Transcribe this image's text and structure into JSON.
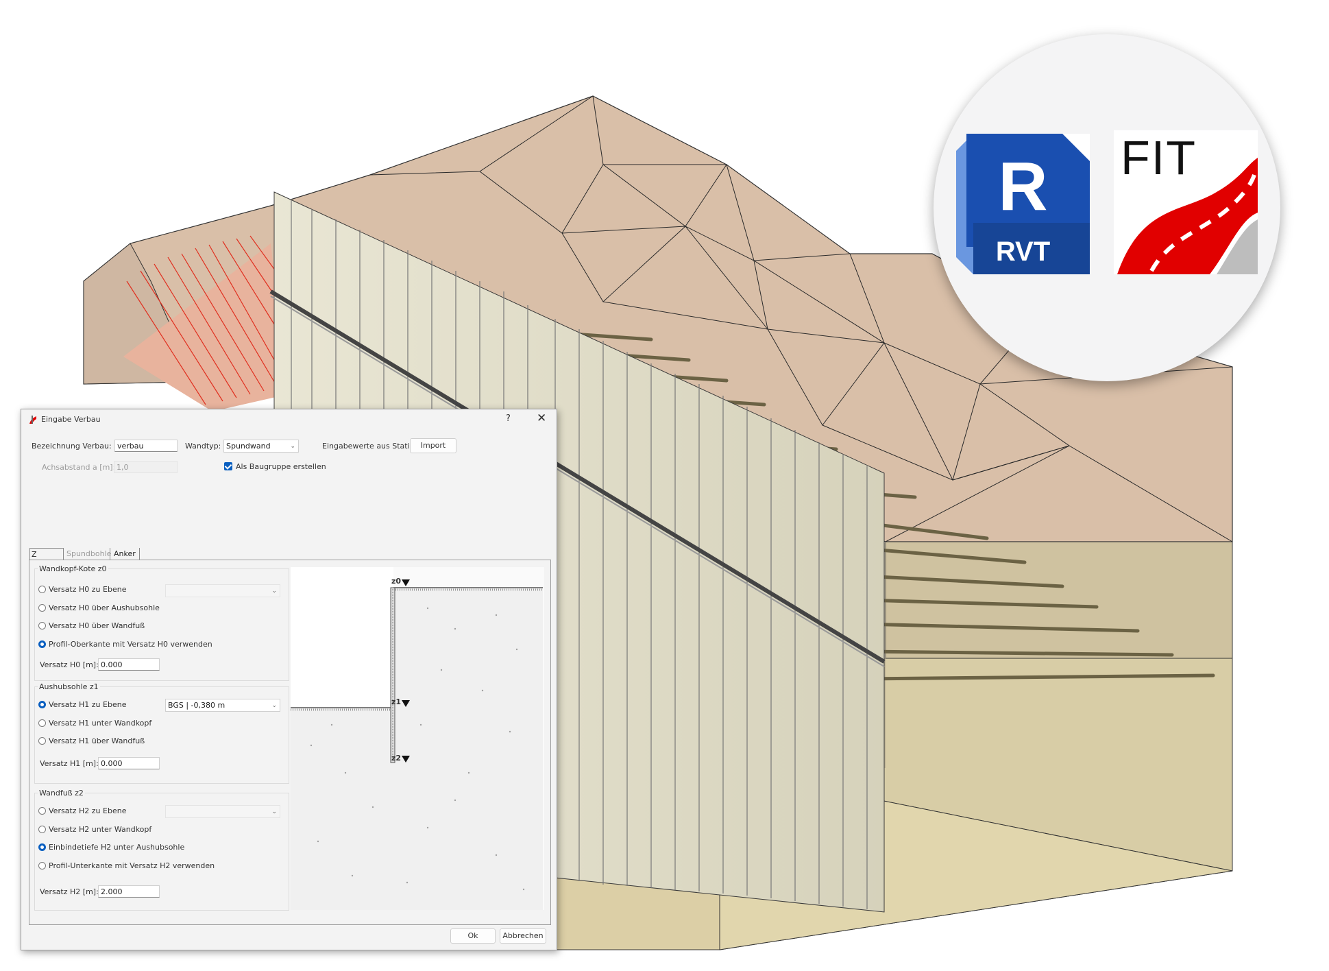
{
  "logos": {
    "rvt": {
      "letter": "R",
      "label": "RVT",
      "color": "#1a4fb0",
      "accent": "#6a97e0"
    },
    "fit": {
      "label": "FIT",
      "road_color": "#e10000"
    }
  },
  "dialog": {
    "title": "Eingabe Verbau",
    "help": "?",
    "close": "✕",
    "bezeichnung_label": "Bezeichnung Verbau:",
    "bezeichnung_value": "verbau",
    "wandtyp_label": "Wandtyp:",
    "wandtyp_value": "Spundwand",
    "statik_label": "Eingabewerte aus Statik:",
    "import_label": "Import",
    "achsabstand_label": "Achsabstand a [m]:",
    "achsabstand_value": "1,0",
    "baugruppe_label": "Als Baugruppe erstellen",
    "baugruppe_checked": true,
    "tabs": [
      "Z Höhen",
      "Spundbohle",
      "Anker"
    ],
    "active_tab": "Z Höhen",
    "groups": {
      "z0": {
        "title": "Wandkopf-Kote z0",
        "options": [
          "Versatz H0 zu Ebene",
          "Versatz H0 über Aushubsohle",
          "Versatz H0 über Wandfuß",
          "Profil-Oberkante mit Versatz H0 verwenden"
        ],
        "selected": 3,
        "select_value": "",
        "field_label": "Versatz H0 [m]:",
        "field_value": "0.000"
      },
      "z1": {
        "title": "Aushubsohle z1",
        "options": [
          "Versatz H1 zu Ebene",
          "Versatz H1 unter Wandkopf",
          "Versatz H1 über Wandfuß"
        ],
        "selected": 0,
        "select_value": "BGS | -0,380 m",
        "field_label": "Versatz H1 [m]:",
        "field_value": "0.000"
      },
      "z2": {
        "title": "Wandfuß z2",
        "options": [
          "Versatz H2 zu Ebene",
          "Versatz H2 unter Wandkopf",
          "Einbindetiefe H2 unter Aushubsohle",
          "Profil-Unterkante mit Versatz H2 verwenden"
        ],
        "selected": 2,
        "select_value": "",
        "field_label": "Versatz H2 [m]:",
        "field_value": "2.000"
      }
    },
    "preview_labels": {
      "z0": "z0",
      "z1": "z1",
      "z2": "z2"
    },
    "ok_label": "Ok",
    "cancel_label": "Abbrechen"
  }
}
